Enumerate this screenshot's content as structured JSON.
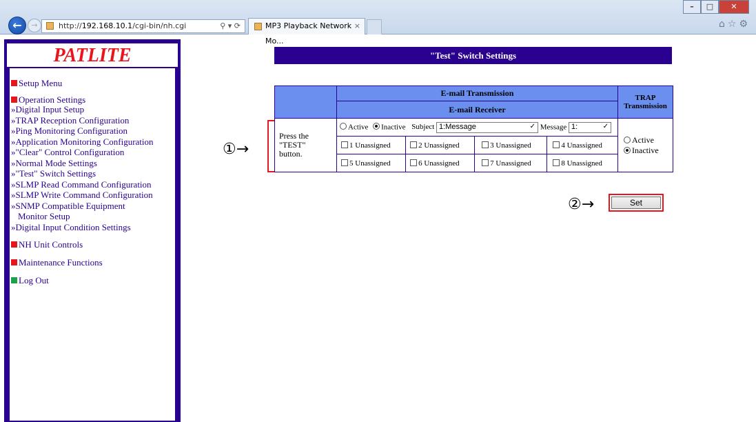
{
  "browser": {
    "url_prefix": "http://",
    "url_host": "192.168.10.1",
    "url_path": "/cgi-bin/nh.cgi",
    "tab_title": "MP3 Playback Network Mo..."
  },
  "sidebar": {
    "logo": "PATLITE",
    "setup_menu": "Setup Menu",
    "operation_settings": "Operation Settings",
    "links": [
      "»Digital Input Setup",
      "»TRAP Reception Configuration",
      "»Ping Monitoring Configuration",
      "»Application Monitoring Configuration",
      "»\"Clear\" Control Configuration",
      "»Normal Mode Settings",
      "»\"Test\" Switch Settings",
      "»SLMP Read Command Configuration",
      "»SLMP Write Command Configuration",
      "»SNMP Compatible Equipment",
      "Monitor Setup",
      "»Digital Input Condition Settings"
    ],
    "nh_unit_controls": "NH Unit Controls",
    "maintenance_functions": "Maintenance Functions",
    "log_out": "Log Out"
  },
  "main": {
    "page_title": "\"Test\" Switch Settings",
    "email_transmission": "E-mail Transmission",
    "email_receiver": "E-mail Receiver",
    "trap_transmission": "TRAP Transmission",
    "row_label": "Press the \"TEST\" button.",
    "active": "Active",
    "inactive": "Inactive",
    "subject_label": "Subject",
    "subject_value": "1:Message",
    "message_label": "Message",
    "message_value": "1:",
    "receivers": [
      "1 Unassigned",
      "2 Unassigned",
      "3 Unassigned",
      "4 Unassigned",
      "5 Unassigned",
      "6 Unassigned",
      "7 Unassigned",
      "8 Unassigned"
    ],
    "email_state": "Inactive",
    "trap_state": "Inactive",
    "set_label": "Set"
  },
  "annotations": {
    "marker1": "①→",
    "marker2": "②→"
  },
  "colors": {
    "brand_navy": "#2a0090",
    "header_blue": "#6a8fef",
    "accent_red": "#e8161c",
    "logout_green": "#1aa34a"
  }
}
